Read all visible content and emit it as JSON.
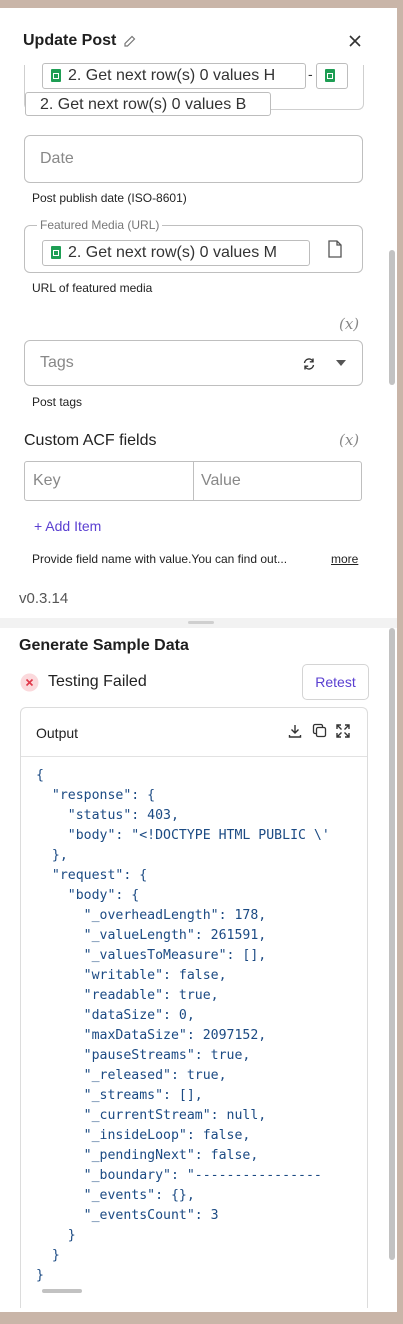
{
  "header": {
    "title": "Update Post"
  },
  "content_field": {
    "chips": [
      "2. Get next row(s) 0 values H",
      "2. Get next row(s) 0 values B"
    ],
    "separator": "-"
  },
  "date_field": {
    "placeholder": "Date",
    "helper": "Post publish date (ISO-8601)"
  },
  "featured_media": {
    "legend": "Featured Media (URL)",
    "chip": "2. Get next row(s) 0 values M",
    "helper": "URL of featured media"
  },
  "tags_field": {
    "xvar": "(x)",
    "placeholder": "Tags",
    "helper": "Post tags"
  },
  "custom_acf": {
    "label": "Custom ACF fields",
    "xvar": "(x)",
    "key_placeholder": "Key",
    "value_placeholder": "Value",
    "add_item": "+ Add Item",
    "helper": "Provide field name with value.You can find out...",
    "more": "more"
  },
  "version": "v0.3.14",
  "sample": {
    "title": "Generate Sample Data",
    "status": "Testing Failed",
    "retest": "Retest",
    "output_label": "Output",
    "code": "{\n  \"response\": {\n    \"status\": 403,\n    \"body\": \"<!DOCTYPE HTML PUBLIC \\'\n  },\n  \"request\": {\n    \"body\": {\n      \"_overheadLength\": 178,\n      \"_valueLength\": 261591,\n      \"_valuesToMeasure\": [],\n      \"writable\": false,\n      \"readable\": true,\n      \"dataSize\": 0,\n      \"maxDataSize\": 2097152,\n      \"pauseStreams\": true,\n      \"_released\": true,\n      \"_streams\": [],\n      \"_currentStream\": null,\n      \"_insideLoop\": false,\n      \"_pendingNext\": false,\n      \"_boundary\": \"----------------\n      \"_events\": {},\n      \"_eventsCount\": 3\n    }\n  }\n}"
  },
  "colors": {
    "accent": "#5a3fd1",
    "error": "#e0394a",
    "sheets": "#1e9e54"
  }
}
